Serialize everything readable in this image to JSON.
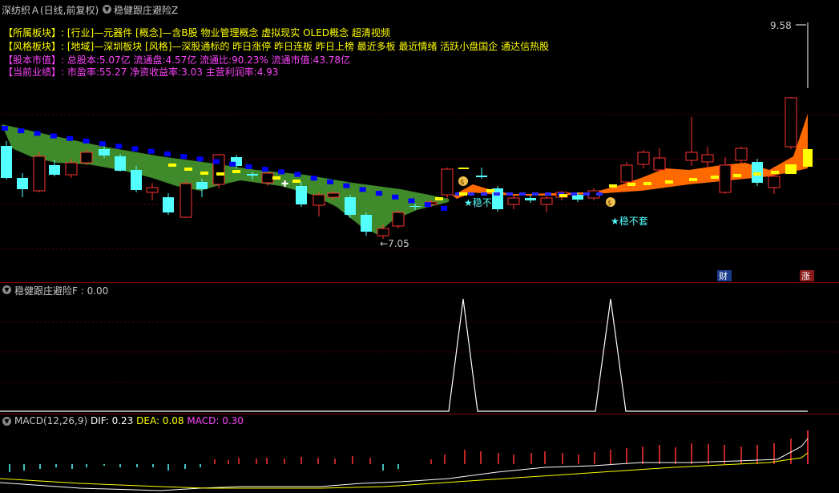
{
  "header": {
    "stock_title": "深纺织Ａ(日线,前复权)",
    "indicator_title": "稳健跟庄避险Z"
  },
  "info": {
    "sector": {
      "label": "【所属板块】:",
      "value": "[行业]—元器件 [概念]—含B股 物业管理概念 虚拟现实 OLED概念 超清视频"
    },
    "style": {
      "label": "【风格板块】:",
      "value": "[地域]—深圳板块 [风格]—深股通标的 昨日涨停 昨日连板 昨日上榜 最近多板 最近情绪 活跃小盘国企 通达信热股"
    },
    "capital": {
      "label": "【股本市值】:",
      "value": "总股本:5.07亿 流通盘:4.57亿 流通比:90.23% 流通市值:43.78亿"
    },
    "perf": {
      "label": "【当前业绩】:",
      "value": "市盈率:55.27 净资收益率:3.03 主营利润率:4.93"
    }
  },
  "main_chart": {
    "high_label": "9.58",
    "low_label": "←7.05",
    "signal_label": "★稳不套",
    "signal_label_2": "★稳不",
    "badge_cai": "财",
    "badge_zhang": "涨",
    "colors": {
      "up": "#ff3232",
      "down": "#54ffff",
      "green_band": "#3f8a2a",
      "orange_band": "#ff6a00",
      "blue_line": "#0000ff",
      "yellow_line": "#ffff00"
    }
  },
  "panel2": {
    "title": "稳健跟庄避险F : 0.00"
  },
  "macd": {
    "label": "MACD(12,26,9)",
    "dif": "DIF: 0.23",
    "dea": "DEA: 0.08",
    "macd": "MACD: 0.30"
  }
}
